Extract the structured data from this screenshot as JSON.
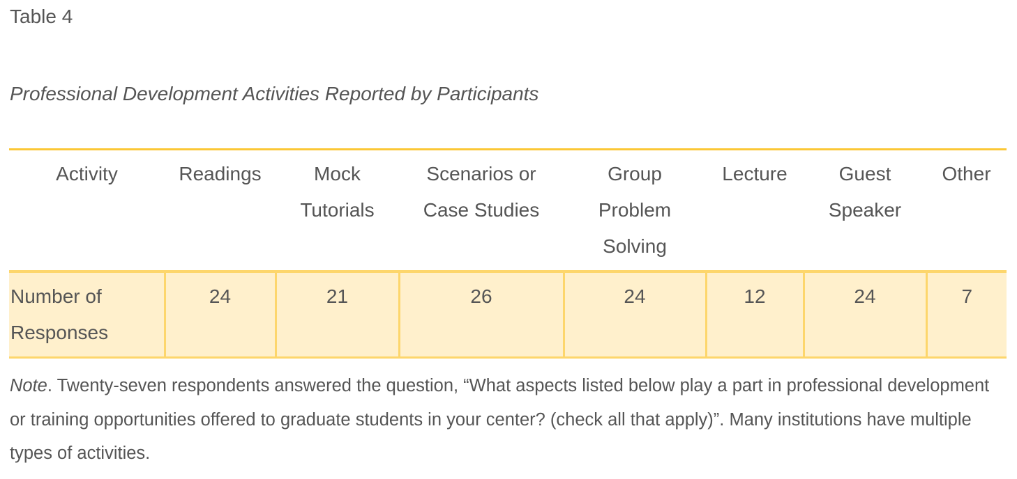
{
  "table_label": "Table 4",
  "table_title": "Professional Development Activities Reported by Participants",
  "table": {
    "header": {
      "row_label": "Activity",
      "columns": [
        "Readings",
        "Mock Tutorials",
        "Scenarios or Case Studies",
        "Group Problem Solving",
        "Lecture",
        "Guest Speaker",
        "Other"
      ]
    },
    "rows": [
      {
        "label": "Number of Responses",
        "values": [
          "24",
          "21",
          "26",
          "24",
          "12",
          "24",
          "7"
        ]
      }
    ]
  },
  "note": {
    "label": "Note",
    "text": ". Twenty-seven respondents answered the question, “What aspects listed below play a part in professional development or training opportunities offered to graduate students in your center? (check all that apply)”. Many institutions have multiple types of activities."
  },
  "colors": {
    "accent_rule": "#fbc736",
    "row_fill": "#fff0cc",
    "row_border": "#fdd66c",
    "text": "#555555"
  }
}
